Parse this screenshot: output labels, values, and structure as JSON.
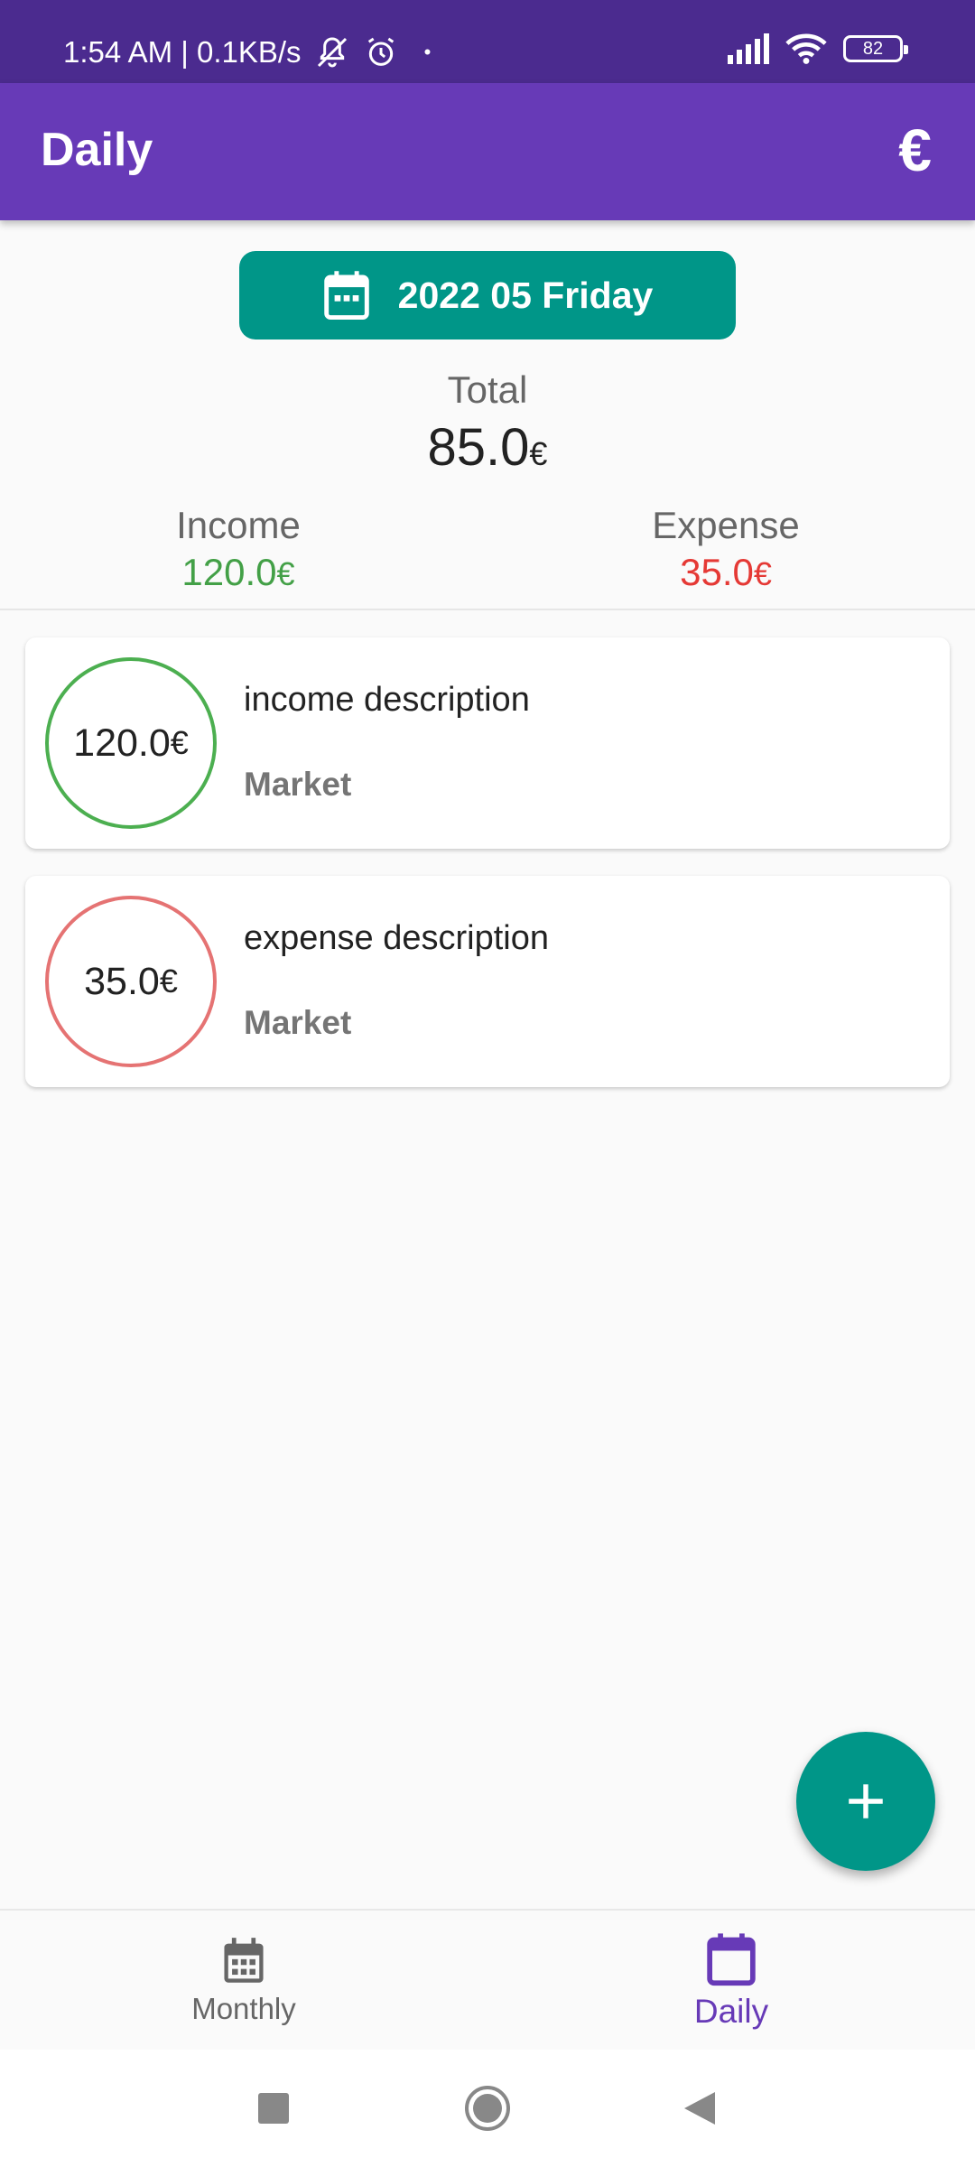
{
  "status_bar": {
    "time_speed": "1:54 AM | 0.1KB/s",
    "dot": "•",
    "battery": "82"
  },
  "app_bar": {
    "title": "Daily",
    "currency_symbol": "€"
  },
  "date_selector": {
    "label": "2022 05 Friday"
  },
  "summary": {
    "total_label": "Total",
    "total_value": "85.0",
    "currency": "€",
    "income_label": "Income",
    "income_value": "120.0",
    "expense_label": "Expense",
    "expense_value": "35.0"
  },
  "transactions": [
    {
      "amount": "120.0",
      "currency": "€",
      "description": "income description",
      "category": "Market",
      "type": "income"
    },
    {
      "amount": "35.0",
      "currency": "€",
      "description": "expense description",
      "category": "Market",
      "type": "expense"
    }
  ],
  "bottom_nav": {
    "items": [
      {
        "label": "Monthly",
        "icon": "calendar-month-icon",
        "active": false
      },
      {
        "label": "Daily",
        "icon": "calendar-day-icon",
        "active": true
      }
    ]
  },
  "fab": {
    "icon": "plus-icon"
  },
  "colors": {
    "primary": "#673ab7",
    "status_bar": "#4b2b8f",
    "accent": "#009688",
    "income": "#43a047",
    "expense": "#e53935"
  }
}
